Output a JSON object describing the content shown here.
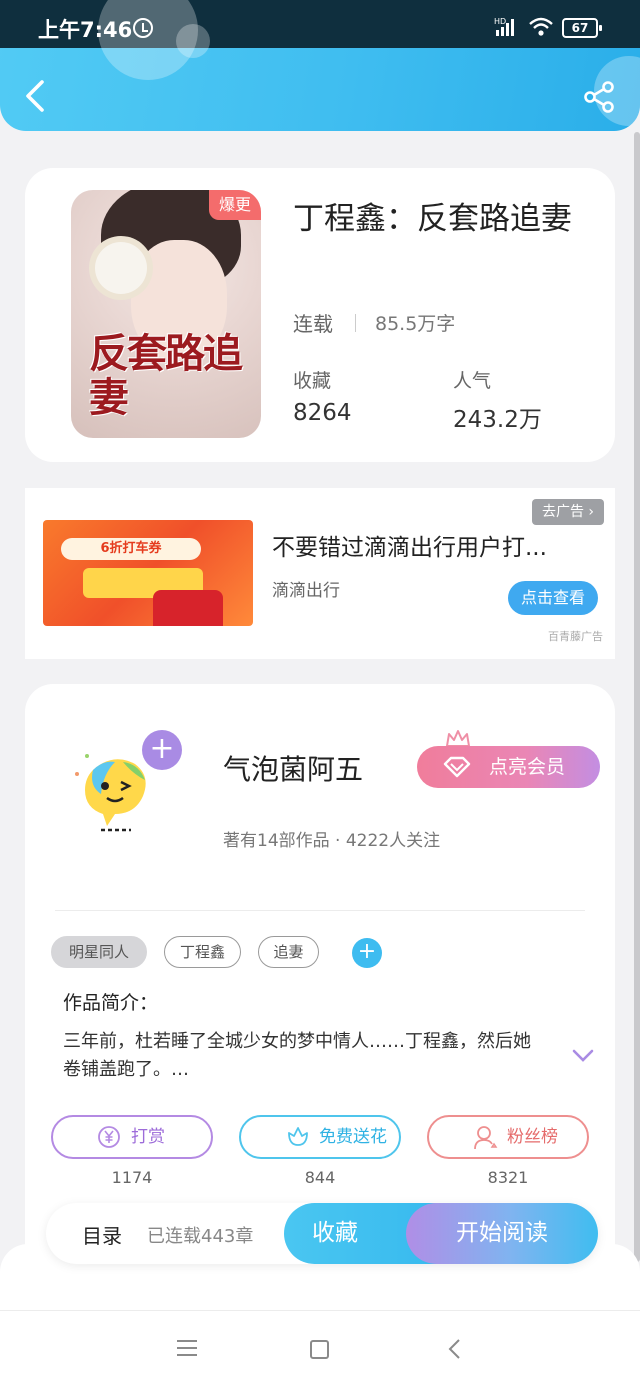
{
  "status_bar": {
    "time": "上午7:46",
    "battery": "67",
    "network": "HD"
  },
  "header": {
    "back_icon": "chevron-left-icon",
    "share_icon": "share-icon"
  },
  "book": {
    "title": "丁程鑫：反套路追妻",
    "cover_badge": "爆更",
    "cover_title": "反套路追妻",
    "status": "连载",
    "word_count": "85.5万字",
    "collect_label": "收藏",
    "collect_value": "8264",
    "popularity_label": "人气",
    "popularity_value": "243.2万"
  },
  "ad": {
    "close_label": "去广告",
    "image_text": "6折打车券",
    "title": "不要错过滴滴出行用户打...",
    "source": "滴滴出行",
    "cta": "点击查看",
    "provider": "百青藤广告"
  },
  "author": {
    "name": "气泡菌阿五",
    "vip_label": "点亮会员",
    "meta": "著有14部作品 · 4222人关注",
    "follow_symbol": "+"
  },
  "tags": [
    {
      "label": "明星同人"
    },
    {
      "label": "丁程鑫"
    },
    {
      "label": "追妻"
    }
  ],
  "tag_add_symbol": "+",
  "intro": {
    "heading": "作品简介：",
    "text": "三年前，杜若睡了全城少女的梦中情人……丁程鑫，然后她卷铺盖跑了。…"
  },
  "actions": [
    {
      "label": "打赏",
      "count": "1174",
      "icon": "yen-icon",
      "color": "#9d6cd9"
    },
    {
      "label": "免费送花",
      "count": "844",
      "icon": "flower-icon",
      "color": "#2fb2e3"
    },
    {
      "label": "粉丝榜",
      "count": "8321",
      "icon": "person-icon",
      "color": "#e56b6b"
    }
  ],
  "bottom_bar": {
    "toc_label": "目录",
    "chapter_count": "已连载443章",
    "collect_label": "收藏",
    "read_label": "开始阅读"
  },
  "colors": {
    "accent_blue": "#3fbdf0",
    "accent_purple": "#b08ee6",
    "badge_red": "#f46c6c"
  }
}
